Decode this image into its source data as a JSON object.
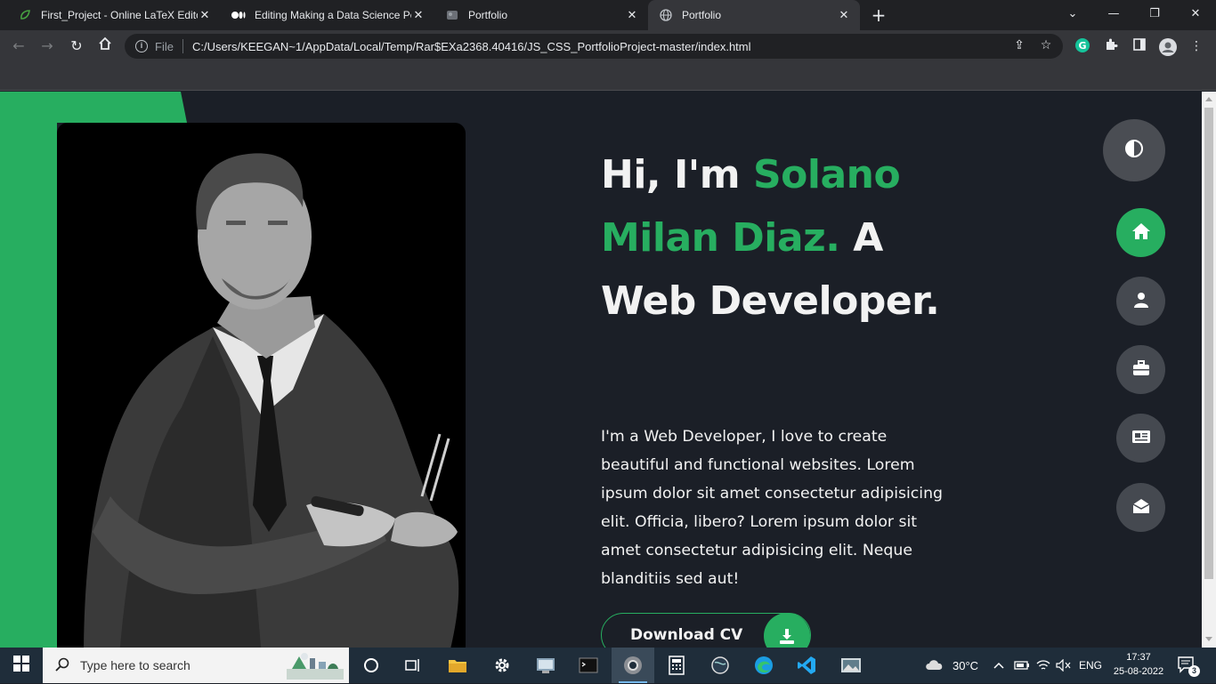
{
  "browser": {
    "tabs": [
      {
        "title": "First_Project - Online LaTeX Editor",
        "favicon": "overleaf-leaf-icon"
      },
      {
        "title": "Editing Making a Data Science Portfolio",
        "favicon": "medium-icon"
      },
      {
        "title": "Portfolio",
        "favicon": "page-icon"
      },
      {
        "title": "Portfolio",
        "favicon": "globe-icon",
        "active": true
      }
    ],
    "address": {
      "scheme_label": "File",
      "url": "C:/Users/KEEGAN~1/AppData/Local/Temp/Rar$EXa2368.40416/JS_CSS_PortfolioProject-master/index.html"
    }
  },
  "page": {
    "hero": {
      "greeting": "Hi, I'm ",
      "name": "Solano Milan Diaz.",
      "role_suffix": " A Web Developer.",
      "description": "I'm a Web Developer, I love to create beautiful and functional websites. Lorem ipsum dolor sit amet consectetur adipisicing elit. Officia, libero? Lorem ipsum dolor sit amet consectetur adipisicing elit. Neque blanditiis sed aut!",
      "cv_button": "Download CV"
    },
    "side_nav": [
      {
        "name": "home",
        "icon": "home-icon",
        "active": true
      },
      {
        "name": "about",
        "icon": "user-icon",
        "active": false
      },
      {
        "name": "portfolio",
        "icon": "briefcase-icon",
        "active": false
      },
      {
        "name": "blogs",
        "icon": "newspaper-icon",
        "active": false
      },
      {
        "name": "contact",
        "icon": "envelope-open-icon",
        "active": false
      }
    ],
    "colors": {
      "accent": "#27ae60",
      "background": "#1b1f27",
      "text": "#f2f2f2"
    }
  },
  "taskbar": {
    "search_placeholder": "Type here to search",
    "weather": "30°C",
    "language": "ENG",
    "time": "17:37",
    "date": "25-08-2022",
    "notifications": "3"
  }
}
